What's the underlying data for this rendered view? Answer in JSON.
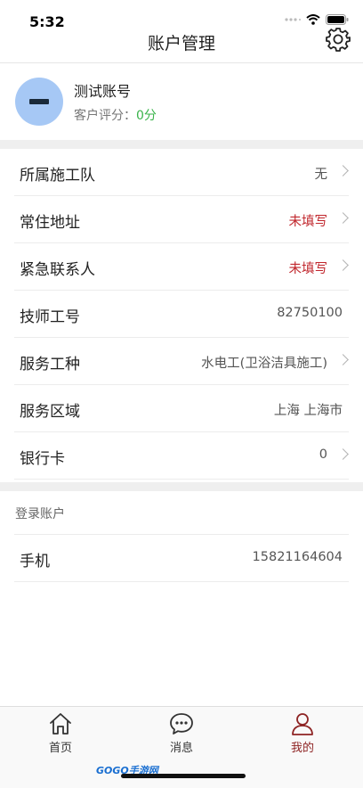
{
  "status_bar": {
    "time": "5:32"
  },
  "header": {
    "title": "账户管理"
  },
  "profile": {
    "name": "测试账号",
    "rating_label": "客户评分：",
    "rating_value": "0分"
  },
  "info_rows": [
    {
      "label": "所属施工队",
      "value": "无",
      "has_arrow": true,
      "warn": false
    },
    {
      "label": "常住地址",
      "value": "未填写",
      "has_arrow": true,
      "warn": true
    },
    {
      "label": "紧急联系人",
      "value": "未填写",
      "has_arrow": true,
      "warn": true
    },
    {
      "label": "技师工号",
      "value": "82750100",
      "has_arrow": false,
      "warn": false
    },
    {
      "label": "服务工种",
      "value": "水电工(卫浴洁具施工)",
      "has_arrow": true,
      "warn": false
    },
    {
      "label": "服务区域",
      "value": "上海 上海市",
      "has_arrow": false,
      "warn": false
    },
    {
      "label": "银行卡",
      "value": "0",
      "has_arrow": true,
      "warn": false
    }
  ],
  "login_section": {
    "header": "登录账户",
    "rows": [
      {
        "label": "手机",
        "value": "15821164604"
      }
    ]
  },
  "tab_bar": {
    "tabs": [
      {
        "label": "首页",
        "icon": "home-icon",
        "active": false
      },
      {
        "label": "消息",
        "icon": "message-icon",
        "active": false
      },
      {
        "label": "我的",
        "icon": "user-icon",
        "active": true
      }
    ]
  },
  "watermark": {
    "text": "GOGO手游网"
  },
  "colors": {
    "warn": "#c0262c",
    "score": "#39b34a",
    "active_tab": "#8e2424",
    "avatar": "#a6c8f5"
  }
}
